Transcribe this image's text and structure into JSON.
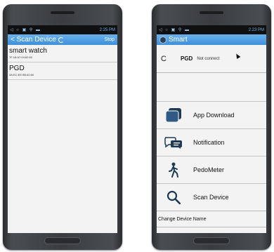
{
  "left_screen": {
    "status_time": "2:25 PM",
    "title": "< Scan Device",
    "stop_label": "Stop",
    "devices": [
      {
        "name": "smart watch",
        "address": "7F:18:A7:04:62:60"
      },
      {
        "name": "PGD",
        "address": "3A:EC:EE:5B:62:60"
      }
    ]
  },
  "right_screen": {
    "status_time": "2:23 PM",
    "title": "Smart",
    "refresh_glyph": "C",
    "device_name": "PGD",
    "connection_status": "Not connect",
    "menu": [
      {
        "label": "App Download",
        "icon": "app-download-icon"
      },
      {
        "label": "Notification",
        "icon": "notification-icon"
      },
      {
        "label": "PedoMeter",
        "icon": "pedometer-icon"
      },
      {
        "label": "Scan Device",
        "icon": "search-icon"
      }
    ],
    "change_device_name": "Change Device Name"
  },
  "colors": {
    "accent": "#4a9ae0",
    "icon_dark": "#1f3a56"
  }
}
